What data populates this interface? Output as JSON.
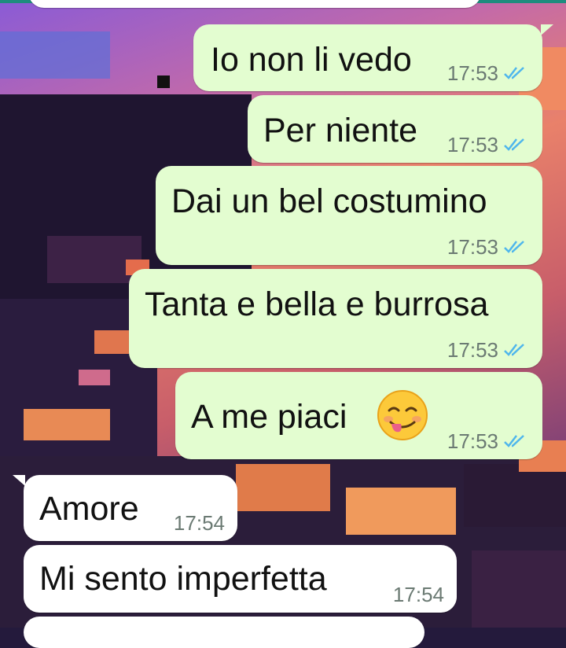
{
  "chat": {
    "outgoing": [
      {
        "text": "Io non li vedo",
        "time": "17:53"
      },
      {
        "text": "Per niente",
        "time": "17:53"
      },
      {
        "text": "Dai un bel costumino",
        "time": "17:53"
      },
      {
        "text": "Tanta e bella e burrosa",
        "time": "17:53"
      },
      {
        "text": "A me piaci",
        "time": "17:53",
        "emoji": "smiling-face-tongue-emoji"
      }
    ],
    "incoming": [
      {
        "text": "Amore",
        "time": "17:54"
      },
      {
        "text": "Mi sento imperfetta",
        "time": "17:54"
      }
    ]
  },
  "colors": {
    "outgoing_bubble": "#e3fdd0",
    "incoming_bubble": "#ffffff",
    "read_ticks": "#4fb6ec",
    "header_accent": "#1e8c7e"
  }
}
